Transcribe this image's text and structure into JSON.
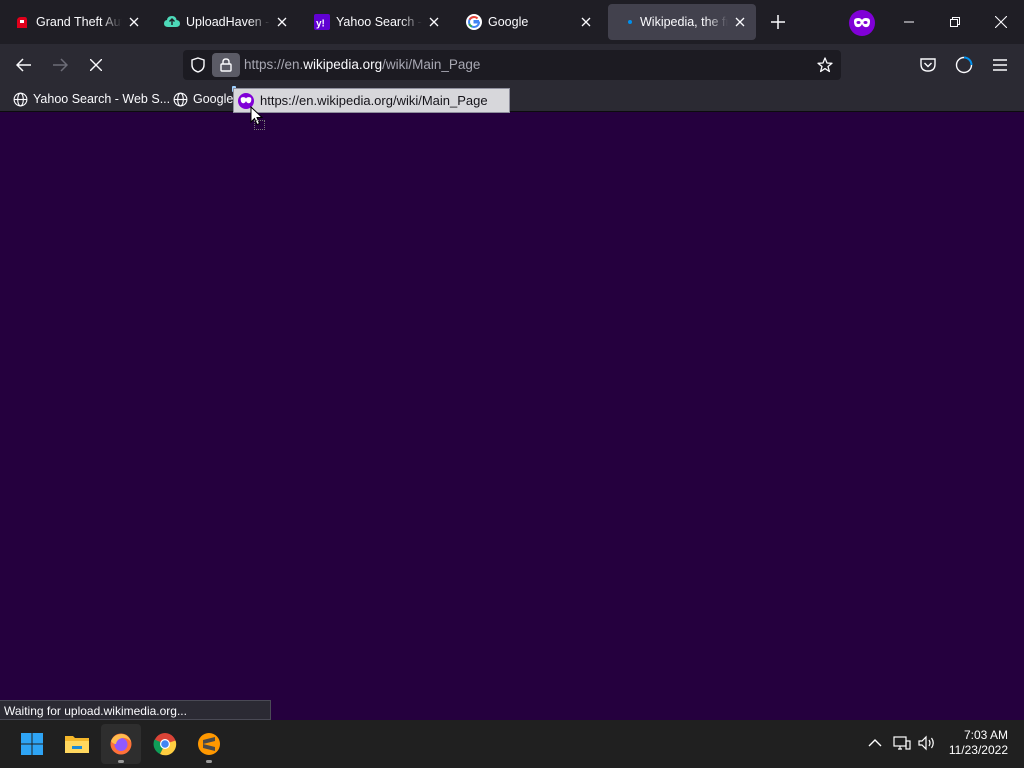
{
  "tabs": [
    {
      "title": "Grand Theft Auto",
      "favicon": "red-game-icon",
      "close": "×"
    },
    {
      "title": "UploadHaven - Fil",
      "favicon": "uploadhaven-cloud-icon",
      "close": "×"
    },
    {
      "title": "Yahoo Search - W",
      "favicon": "yahoo-icon",
      "close": "×"
    },
    {
      "title": "Google",
      "favicon": "google-icon",
      "close": "×"
    },
    {
      "title": "Wikipedia, the fre",
      "favicon": "loading-dot-icon",
      "close": "×",
      "active": true
    }
  ],
  "navbar": {
    "url_prefix": "https://en.",
    "url_host": "wikipedia.org",
    "url_path": "/wiki/Main_Page"
  },
  "bookmarks": [
    {
      "label": "Yahoo Search - Web S..."
    },
    {
      "label": "Google"
    }
  ],
  "drag_preview": {
    "text": "https://en.wikipedia.org/wiki/Main_Page"
  },
  "status": {
    "text": "Waiting for upload.wikimedia.org..."
  },
  "taskbar": {
    "apps": [
      "windows-start-icon",
      "file-explorer-icon",
      "firefox-icon",
      "chrome-icon",
      "sublime-text-icon"
    ],
    "time": "7:03 AM",
    "date": "11/23/2022"
  },
  "colors": {
    "content_bg": "#25003e",
    "private_accent": "#8000d7",
    "toolbar": "#2b2a33",
    "tabstrip": "#1f1e25"
  }
}
